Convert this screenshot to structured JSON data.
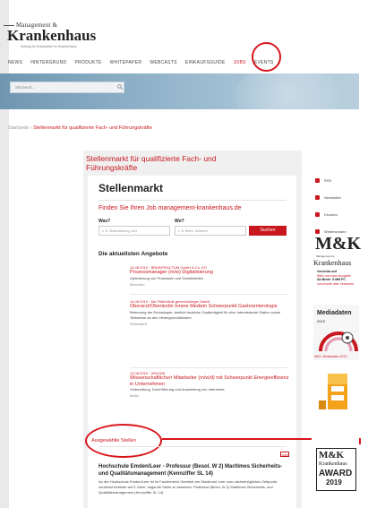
{
  "header": {
    "logo_small": "Management &",
    "logo_big": "Krankenhaus",
    "logo_tag": "Zeitung für Entscheider im Krankenhaus",
    "nav": [
      "NEWS",
      "HINTERGRUND",
      "PRODUKTE",
      "WHITEPAPER",
      "WEBCASTS",
      "EINKAUFSGUIDE",
      "JOBS",
      "EVENTS"
    ],
    "active_nav_index": 6
  },
  "search": {
    "placeholder": "Stichwort..."
  },
  "breadcrumb": {
    "home": "Startseite",
    "separator": "›",
    "current": "Stellenmarkt für qualifizierte Fach- und Führungskräfte"
  },
  "main": {
    "title": "Stellenmarkt für qualifizierte Fach- und Führungskräfte",
    "heading": "Stellenmarkt",
    "find_text": "Finden Sie Ihren Job management-krankenhaus.de",
    "was_label": "Was?",
    "wo_label": "Wo?",
    "was_placeholder": "z. B. Stationsleitung, Arzt",
    "wo_placeholder": "z. B. Berlin, München",
    "search_button": "Suchen",
    "offers_heading": "Die aktuellsten Angebote",
    "jobs": [
      {
        "date": "14.08.2019 · BRAINTRACTUM GmbH & Co. KG",
        "title": "Prozessmanager (m/w) Digitalisierung",
        "desc": "Optimierung von Prozessen und Schnittstellen",
        "loc": "München"
      },
      {
        "date": "14.08.2019 · Die Filderklinik gemeinnützige GmbH",
        "title": "Oberarzt/Oberärztin Innere Medizin Schwerpunkt Gastroenterologie",
        "desc": "Betreuung der Endoskopie, ärztlich fachliche Zuständigkeit für eine Internistische Station sowie Teilnahme an den Hintergrunddiensten",
        "loc": "Filderstadt"
      },
      {
        "date": "14.08.2019 · VDI/VDE",
        "title": "Wissenschaftliche/r Mitarbeiter (m/w/d) mit Schwerpunkt Energieeffizienz in Unternehmen",
        "desc": "Vorbereitung, Durchführung und Auswertung von Interviews",
        "loc": "Berlin"
      }
    ],
    "featured_heading": "Ausgewählte Stellen",
    "featured_badge": "JOBS",
    "featured_title": "Hochschule Emden/Leer - Professur (Besol. W 2) Maritimes Sicherheits- und Qualitätsmanagement (Kennziffer SL 14)",
    "featured_desc": "An der Hochschule Emden/Leer ist im Fachbereich Seefahrt am Studienort Leer zum nächstmöglichen Zeitpunkt, zunächst befristet auf 5 Jahre, folgende Stelle zu besetzen: Professur (Besol. W 2) Maritimes Sicherheits- und Qualitätsmanagement (Kennziffer SL 14)"
  },
  "sidebar": {
    "items": [
      "RSS",
      "Newsletter",
      "Drucken",
      "Weitersenden"
    ],
    "mk_logo": "M&K",
    "mk_sub": "Krankenhaus",
    "mk_line": "Management &",
    "vorschau_label": "Vorschau auf",
    "vorschau_text": "M&K und neue Ausgabe",
    "vorschau_bold": "Ab Beste: 5.MM PC",
    "vorschau_link": "zum Archiv aller Versionen",
    "media_title": "Mediadaten",
    "media_year": "2019",
    "media_caption": "NEU: Mediadaten 2019",
    "award_mk": "M&K",
    "award_kh": "Krankenhaus",
    "award_label": "AWARD",
    "award_year": "2019"
  },
  "colors": {
    "accent": "#c8171e",
    "banner": "#8fb2c9"
  }
}
